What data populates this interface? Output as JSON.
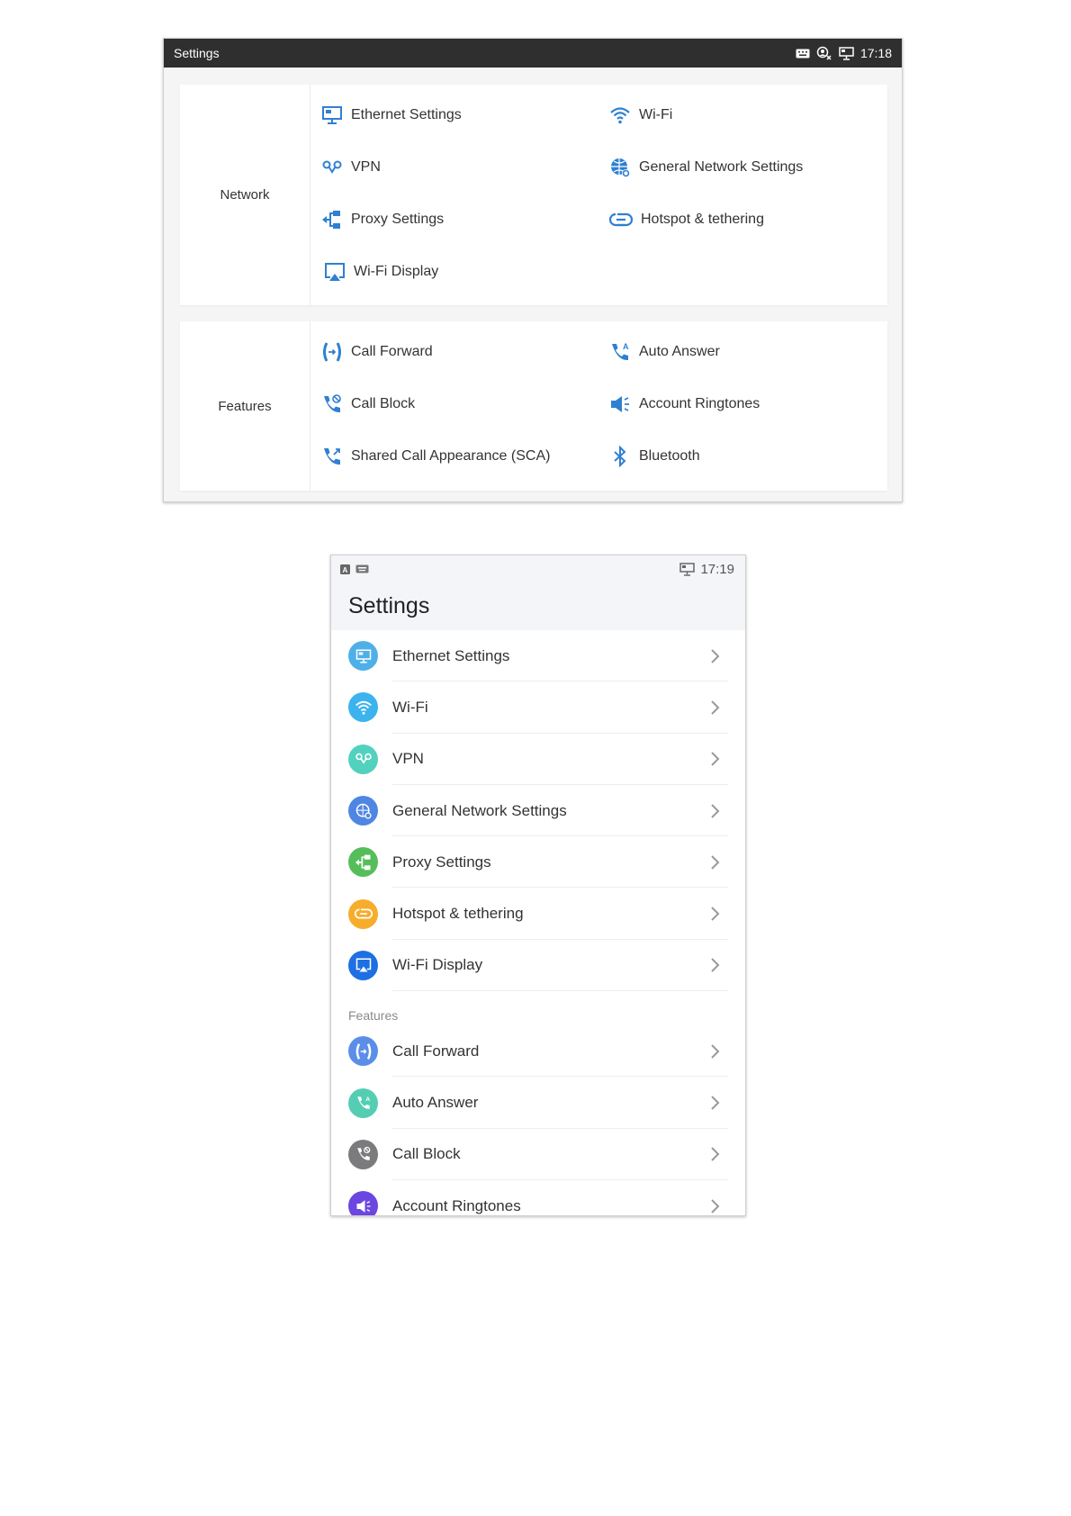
{
  "landscape": {
    "title": "Settings",
    "time": "17:18",
    "status_icons": [
      "keyboard-icon",
      "user-blocked-icon",
      "ethernet-icon"
    ],
    "sections": [
      {
        "label": "Network",
        "items": [
          {
            "label": "Ethernet Settings",
            "icon": "ethernet-icon"
          },
          {
            "label": "Wi-Fi",
            "icon": "wifi-icon"
          },
          {
            "label": "VPN",
            "icon": "vpn-icon"
          },
          {
            "label": "General Network Settings",
            "icon": "globe-gear-icon"
          },
          {
            "label": "Proxy Settings",
            "icon": "proxy-icon"
          },
          {
            "label": "Hotspot & tethering",
            "icon": "hotspot-icon"
          },
          {
            "label": "Wi-Fi Display",
            "icon": "cast-screen-icon"
          }
        ]
      },
      {
        "label": "Features",
        "items": [
          {
            "label": "Call Forward",
            "icon": "call-forward-icon"
          },
          {
            "label": "Auto Answer",
            "icon": "auto-answer-icon"
          },
          {
            "label": "Call Block",
            "icon": "call-block-icon"
          },
          {
            "label": "Account Ringtones",
            "icon": "speaker-icon"
          },
          {
            "label": "Shared Call Appearance (SCA)",
            "icon": "shared-call-icon"
          },
          {
            "label": "Bluetooth",
            "icon": "bluetooth-icon"
          }
        ]
      }
    ],
    "accent_color": "#2f80d1"
  },
  "portrait": {
    "time": "17:19",
    "title": "Settings",
    "network_items": [
      {
        "label": "Ethernet Settings",
        "icon": "ethernet-icon",
        "color": "#4fb0e8"
      },
      {
        "label": "Wi-Fi",
        "icon": "wifi-icon",
        "color": "#3ab3ee"
      },
      {
        "label": "VPN",
        "icon": "vpn-icon",
        "color": "#52d1bf"
      },
      {
        "label": "General Network Settings",
        "icon": "globe-gear-icon",
        "color": "#4f86e3"
      },
      {
        "label": "Proxy Settings",
        "icon": "proxy-icon",
        "color": "#55be5b"
      },
      {
        "label": "Hotspot & tethering",
        "icon": "hotspot-icon",
        "color": "#f6ad2c"
      },
      {
        "label": "Wi-Fi Display",
        "icon": "cast-screen-icon",
        "color": "#1e6fe3"
      }
    ],
    "features_label": "Features",
    "feature_items": [
      {
        "label": "Call Forward",
        "icon": "call-forward-icon",
        "color": "#5b8ee8"
      },
      {
        "label": "Auto Answer",
        "icon": "auto-answer-icon",
        "color": "#55cdb3"
      },
      {
        "label": "Call Block",
        "icon": "call-block-icon",
        "color": "#7b7b7d"
      },
      {
        "label": "Account Ringtones",
        "icon": "speaker-icon",
        "color": "#6c46e0"
      }
    ]
  }
}
